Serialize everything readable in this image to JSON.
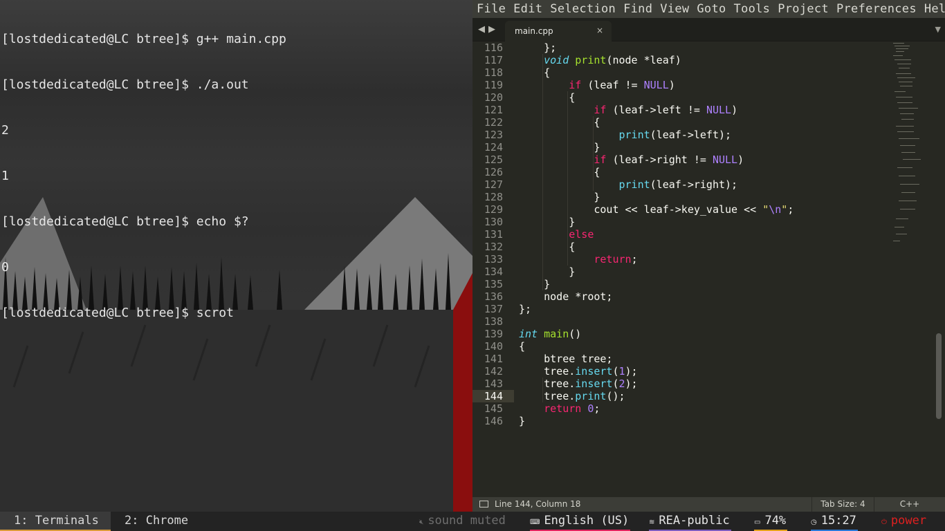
{
  "terminal": {
    "lines": [
      "[lostdedicated@LC btree]$ g++ main.cpp",
      "[lostdedicated@LC btree]$ ./a.out",
      "2",
      "1",
      "[lostdedicated@LC btree]$ echo $?",
      "0",
      "[lostdedicated@LC btree]$ scrot"
    ]
  },
  "editor": {
    "menu": [
      "File",
      "Edit",
      "Selection",
      "Find",
      "View",
      "Goto",
      "Tools",
      "Project",
      "Preferences",
      "Hel"
    ],
    "tab": {
      "title": "main.cpp",
      "close_glyph": "×"
    },
    "nav": {
      "back": "◀",
      "forward": "▶",
      "menu": "▼"
    },
    "first_line_number": 116,
    "current_line": 144,
    "code": [
      [
        [
          "    };",
          ""
        ]
      ],
      [
        [
          "    ",
          ""
        ],
        [
          "void",
          "type"
        ],
        [
          " ",
          ""
        ],
        [
          "print",
          "fn"
        ],
        [
          "(node *leaf)",
          ""
        ]
      ],
      [
        [
          "    {",
          ""
        ]
      ],
      [
        [
          "        ",
          ""
        ],
        [
          "if",
          "kw"
        ],
        [
          " (leaf != ",
          ""
        ],
        [
          "NULL",
          "const"
        ],
        [
          ")",
          ""
        ]
      ],
      [
        [
          "        {",
          ""
        ]
      ],
      [
        [
          "            ",
          ""
        ],
        [
          "if",
          "kw"
        ],
        [
          " (leaf->left != ",
          ""
        ],
        [
          "NULL",
          "const"
        ],
        [
          ")",
          ""
        ]
      ],
      [
        [
          "            {",
          ""
        ]
      ],
      [
        [
          "                ",
          ""
        ],
        [
          "print",
          "call"
        ],
        [
          "(leaf->left);",
          ""
        ]
      ],
      [
        [
          "            }",
          ""
        ]
      ],
      [
        [
          "            ",
          ""
        ],
        [
          "if",
          "kw"
        ],
        [
          " (leaf->right != ",
          ""
        ],
        [
          "NULL",
          "const"
        ],
        [
          ")",
          ""
        ]
      ],
      [
        [
          "            {",
          ""
        ]
      ],
      [
        [
          "                ",
          ""
        ],
        [
          "print",
          "call"
        ],
        [
          "(leaf->right);",
          ""
        ]
      ],
      [
        [
          "            }",
          ""
        ]
      ],
      [
        [
          "            cout << leaf->key_value << ",
          ""
        ],
        [
          "\"",
          "str"
        ],
        [
          "\\n",
          "const"
        ],
        [
          "\"",
          "str"
        ],
        [
          ";",
          ""
        ]
      ],
      [
        [
          "        }",
          ""
        ]
      ],
      [
        [
          "        ",
          ""
        ],
        [
          "else",
          "kw"
        ]
      ],
      [
        [
          "        {",
          ""
        ]
      ],
      [
        [
          "            ",
          ""
        ],
        [
          "return",
          "kw"
        ],
        [
          ";",
          ""
        ]
      ],
      [
        [
          "        }",
          ""
        ]
      ],
      [
        [
          "    }",
          ""
        ]
      ],
      [
        [
          "    node *root;",
          ""
        ]
      ],
      [
        [
          "};",
          ""
        ]
      ],
      [
        [
          "",
          ""
        ]
      ],
      [
        [
          "int",
          "type"
        ],
        [
          " ",
          ""
        ],
        [
          "main",
          "fn"
        ],
        [
          "()",
          ""
        ]
      ],
      [
        [
          "{",
          ""
        ]
      ],
      [
        [
          "    btree tree;",
          ""
        ]
      ],
      [
        [
          "    tree.",
          ""
        ],
        [
          "insert",
          "call"
        ],
        [
          "(",
          ""
        ],
        [
          "1",
          "const"
        ],
        [
          ");",
          ""
        ]
      ],
      [
        [
          "    tree.",
          ""
        ],
        [
          "insert",
          "call"
        ],
        [
          "(",
          ""
        ],
        [
          "2",
          "const"
        ],
        [
          ");",
          ""
        ]
      ],
      [
        [
          "    tree.",
          ""
        ],
        [
          "print",
          "call"
        ],
        [
          "();",
          ""
        ]
      ],
      [
        [
          "    ",
          ""
        ],
        [
          "return",
          "kw"
        ],
        [
          " ",
          ""
        ],
        [
          "0",
          "const"
        ],
        [
          ";",
          ""
        ]
      ],
      [
        [
          "}",
          ""
        ]
      ]
    ],
    "status": {
      "position": "Line 144, Column 18",
      "tab_size": "Tab Size: 4",
      "syntax": "C++"
    }
  },
  "bar": {
    "workspaces": [
      {
        "label": "1: Terminals",
        "active": true
      },
      {
        "label": "2: Chrome",
        "active": false
      }
    ],
    "sound": "sound muted",
    "language": "English (US)",
    "wifi": "REA-public",
    "battery": "74%",
    "clock": "15:27",
    "power": "power",
    "colors": {
      "language": "#e0245e",
      "wifi": "#7c5cbf",
      "battery": "#e3a21a",
      "clock": "#2979d9",
      "power": "#e02020",
      "active_workspace": "#d99a3a"
    }
  }
}
